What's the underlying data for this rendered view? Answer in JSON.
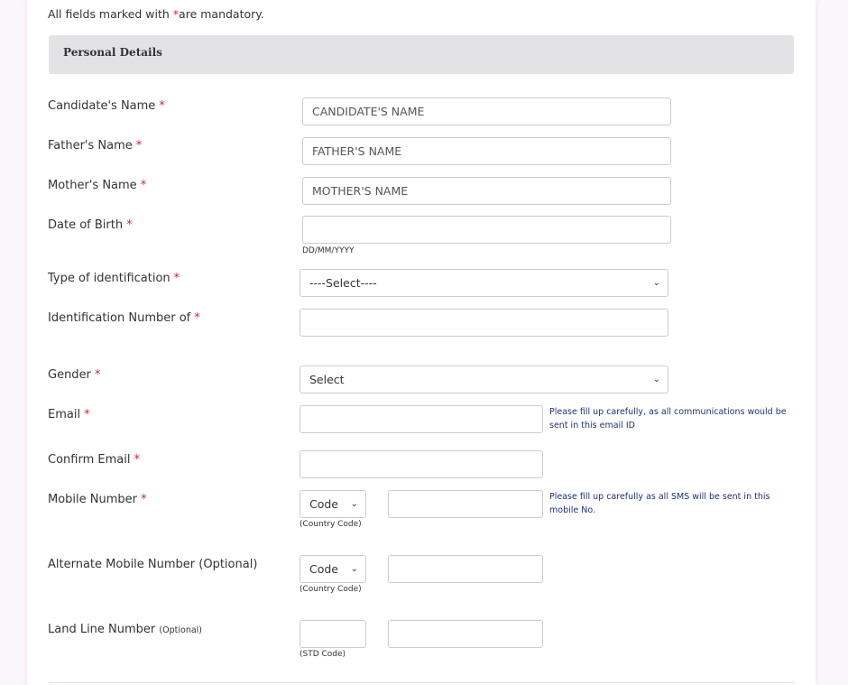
{
  "form": {
    "mandatory_prefix": "All fields marked with ",
    "mandatory_star": "*",
    "mandatory_suffix": "are mandatory.",
    "section_title": "Personal Details",
    "required_marker": "*"
  },
  "fields": {
    "candidate_name": {
      "label": "Candidate's Name",
      "placeholder": "CANDIDATE'S NAME"
    },
    "father_name": {
      "label": "Father's Name",
      "placeholder": "FATHER'S NAME"
    },
    "mother_name": {
      "label": "Mother's Name",
      "placeholder": "MOTHER'S NAME"
    },
    "dob": {
      "label": "Date of Birth",
      "value": "",
      "hint": "DD/MM/YYYY"
    },
    "id_type": {
      "label": "Type of identification",
      "selected": "----Select----"
    },
    "id_number": {
      "label": "Identification Number of",
      "value": ""
    },
    "gender": {
      "label": "Gender",
      "selected": "Select"
    },
    "email": {
      "label": "Email",
      "value": "",
      "note": "Please fill up carefully, as all communications would be sent in this email ID"
    },
    "confirm_email": {
      "label": "Confirm Email",
      "value": ""
    },
    "mobile": {
      "label": "Mobile Number",
      "code_selected": "Code",
      "code_hint": "(Country Code)",
      "value": "",
      "note": "Please fill up carefully as all SMS will be sent in this mobile No."
    },
    "alt_mobile": {
      "label": "Alternate Mobile Number (Optional)",
      "code_selected": "Code",
      "code_hint": "(Country Code)",
      "value": ""
    },
    "landline": {
      "label": "Land Line Number",
      "label_suffix": "(Optional)",
      "std_value": "",
      "std_hint": "(STD Code)",
      "value": ""
    }
  },
  "icons": {
    "dropdown": "chevron-down-icon"
  },
  "colors": {
    "required": "#d9232d",
    "note_text": "#1f2f7a",
    "section_bg": "#e3e3e6"
  }
}
